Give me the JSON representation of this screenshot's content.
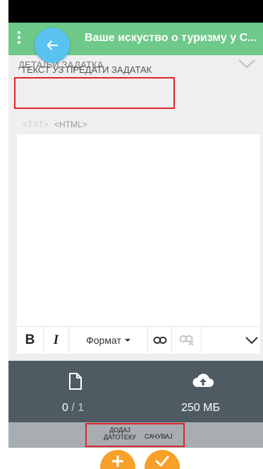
{
  "app": {
    "title": "Ваше искуство о туризму у С...",
    "primary_color": "#6fc98a",
    "fab_back_color": "#59c2f0",
    "fab_action_color": "#f7a02a"
  },
  "icons": {
    "menu": "more-vertical-icon",
    "back": "arrow-left-icon",
    "collapse": "chevron-down-icon",
    "file": "file-icon",
    "cloud": "cloud-upload-icon",
    "add": "plus-icon",
    "save": "check-icon"
  },
  "section": {
    "label": "ДЕТАЉИ ЗАДАТКА"
  },
  "field": {
    "label": "ТЕКСТ УЗ ПРЕДАТИ ЗАДАТАК",
    "modes": [
      "<TXT>",
      "<HTML>"
    ]
  },
  "editor": {
    "value": "",
    "toolbar": {
      "bold": "B",
      "italic": "I",
      "format": "Формат"
    }
  },
  "files": {
    "count": "0",
    "max": "1",
    "space": "250 МБ"
  },
  "actions": {
    "add_file_line1": "ДОДАЈ",
    "add_file_line2": "ДАТОТЕКУ",
    "save": "САЧУВАЈ"
  }
}
